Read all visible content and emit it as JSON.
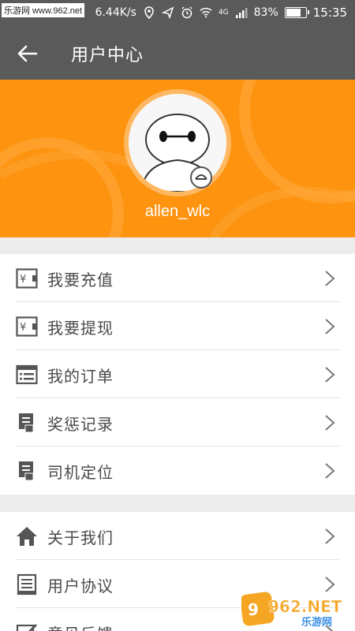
{
  "status_bar": {
    "watermark": "乐游网 www.962.net",
    "speed": "6.44K/s",
    "network": "4G",
    "battery_percent": "83%",
    "battery_level": 0.83,
    "time": "15:35"
  },
  "app_bar": {
    "title": "用户中心",
    "back_icon": "arrow-left-icon"
  },
  "profile": {
    "username": "allen_wlc",
    "header_color": "#fd930f"
  },
  "menu_group_1": [
    {
      "label": "我要充值",
      "icon": "wallet-icon"
    },
    {
      "label": "我要提现",
      "icon": "wallet-icon"
    },
    {
      "label": "我的订单",
      "icon": "list-icon"
    },
    {
      "label": "奖惩记录",
      "icon": "bookmark-doc-icon"
    },
    {
      "label": "司机定位",
      "icon": "bookmark-doc-icon"
    }
  ],
  "menu_group_2": [
    {
      "label": "关于我们",
      "icon": "home-icon"
    },
    {
      "label": "用户协议",
      "icon": "document-icon"
    },
    {
      "label": "意见反馈",
      "icon": "edit-icon"
    }
  ],
  "watermark_logo": {
    "text": "962.NET",
    "subtext": "乐游网"
  }
}
